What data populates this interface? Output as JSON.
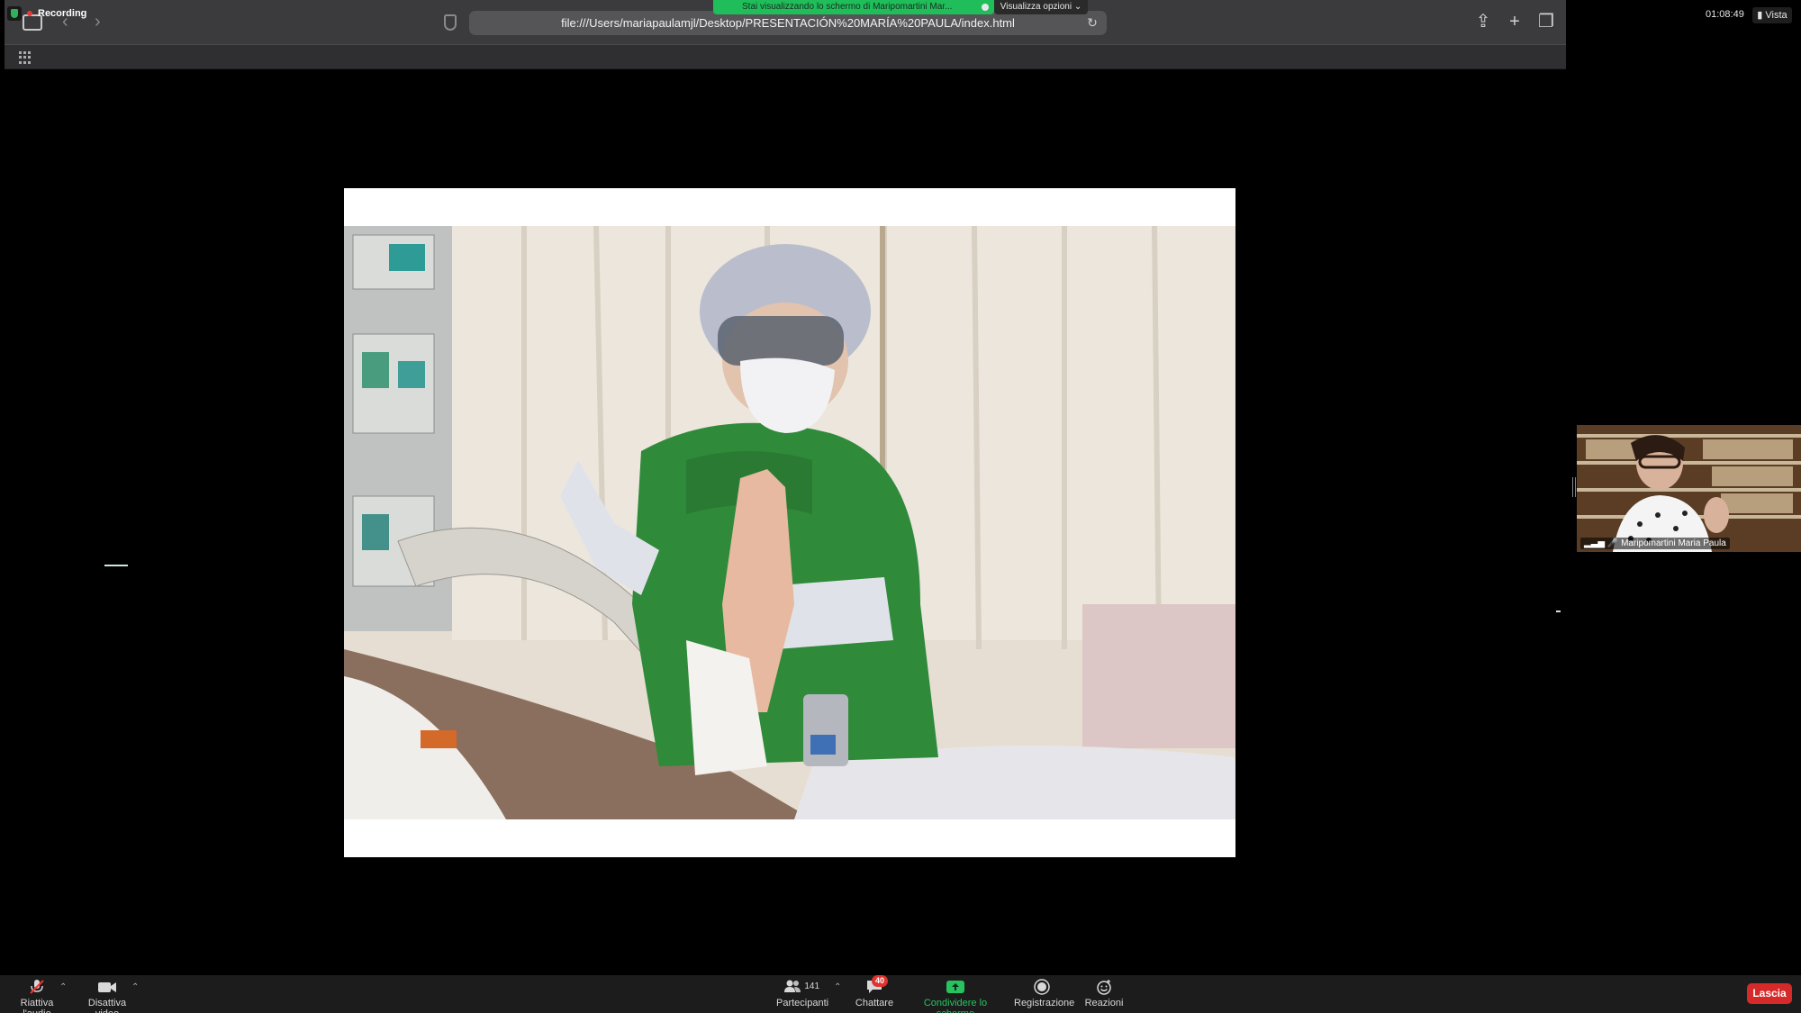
{
  "recording": {
    "label": "Recording"
  },
  "share_banner": {
    "text": "Stai visualizzando lo schermo di Maripomartini Mar...",
    "view_options": "Visualizza opzioni ⌄"
  },
  "browser": {
    "url": "file:///Users/mariapaulamjl/Desktop/PRESENTACIÓN%20MARÍA%20PAULA/index.html"
  },
  "meeting": {
    "clock": "01:08:49",
    "view_label": "Vista"
  },
  "participant_tile": {
    "name": "Maripomartini Maria Paula"
  },
  "toolbar": {
    "audio": "Riattiva l'audio",
    "video": "Disattiva video",
    "participants": "Partecipanti",
    "participants_count": "141",
    "chat": "Chattare",
    "chat_badge": "40",
    "share": "Condividere lo schermo",
    "record": "Registrazione",
    "reactions": "Reazioni",
    "leave": "Lascia"
  },
  "colors": {
    "share_green": "#1fbe5a",
    "leave_red": "#d62a2a",
    "gown_green": "#2f8a3a"
  },
  "icons": [
    "sidebar-icon",
    "back-icon",
    "forward-icon",
    "shield-icon",
    "reload-icon",
    "share-icon",
    "plus-icon",
    "tabs-icon",
    "grid-icon",
    "mic-muted-icon",
    "video-icon",
    "participants-icon",
    "chat-icon",
    "share-screen-icon",
    "record-icon",
    "reactions-icon"
  ]
}
